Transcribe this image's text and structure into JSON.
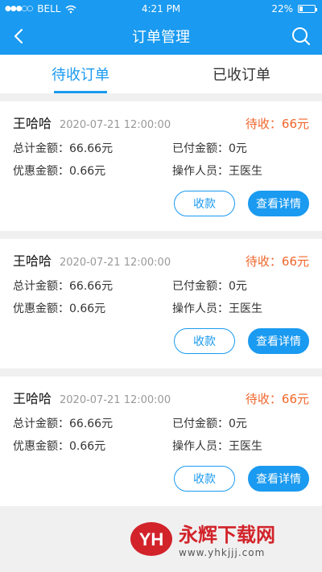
{
  "status_bar": {
    "carrier": "BELL",
    "time": "4:21 PM",
    "battery": "22%"
  },
  "nav": {
    "title": "订单管理"
  },
  "tabs": [
    {
      "label": "待收订单",
      "active": true
    },
    {
      "label": "已收订单",
      "active": false
    }
  ],
  "orders": [
    {
      "name": "王哈哈",
      "time": "2020-07-21 12:00:00",
      "status": "待收：66元",
      "total_label": "总计金额：",
      "total": "66.66元",
      "paid_label": "已付金额：",
      "paid": "0元",
      "discount_label": "优惠金额：",
      "discount": "0.66元",
      "operator_label": "操作人员：",
      "operator": "王医生",
      "collect_label": "收款",
      "detail_label": "查看详情"
    },
    {
      "name": "王哈哈",
      "time": "2020-07-21 12:00:00",
      "status": "待收：66元",
      "total_label": "总计金额：",
      "total": "66.66元",
      "paid_label": "已付金额：",
      "paid": "0元",
      "discount_label": "优惠金额：",
      "discount": "0.66元",
      "operator_label": "操作人员：",
      "operator": "王医生",
      "collect_label": "收款",
      "detail_label": "查看详情"
    },
    {
      "name": "王哈哈",
      "time": "2020-07-21 12:00:00",
      "status": "待收：66元",
      "total_label": "总计金额：",
      "total": "66.66元",
      "paid_label": "已付金额：",
      "paid": "0元",
      "discount_label": "优惠金额：",
      "discount": "0.66元",
      "operator_label": "操作人员：",
      "operator": "王医生",
      "collect_label": "收款",
      "detail_label": "查看详情"
    }
  ],
  "watermark": {
    "text": "永辉下载网",
    "url": "www.yhkjjj.com",
    "logo": "YH"
  },
  "colors": {
    "primary": "#1a9af0",
    "pending": "#f0662b",
    "watermark": "#d2232a"
  }
}
